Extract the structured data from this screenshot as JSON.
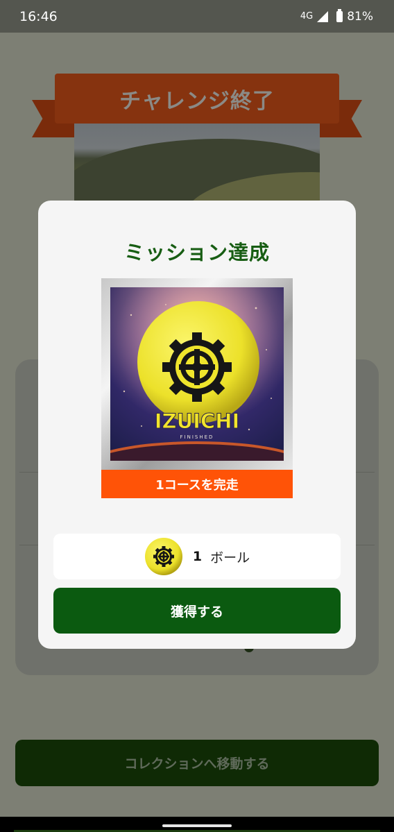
{
  "status_bar": {
    "time": "16:46",
    "network": "4G",
    "battery": "81%"
  },
  "background_screen": {
    "banner_title": "チャレンジ終了",
    "collection_button_label": "コレクションへ移動する"
  },
  "dialog": {
    "title": "ミッション達成",
    "badge": {
      "art_title": "IZUICHI",
      "art_subtitle": "FINISHED",
      "label": "1コースを完走"
    },
    "reward": {
      "count": "1",
      "unit": "ボール",
      "icon": "gear-ball-icon"
    },
    "obtain_button_label": "獲得する"
  },
  "colors": {
    "dialog_title": "#175d13",
    "obtain_button": "#0b5a10",
    "badge_label_bg": "#ff5307",
    "ball": "#f2ea2a"
  }
}
